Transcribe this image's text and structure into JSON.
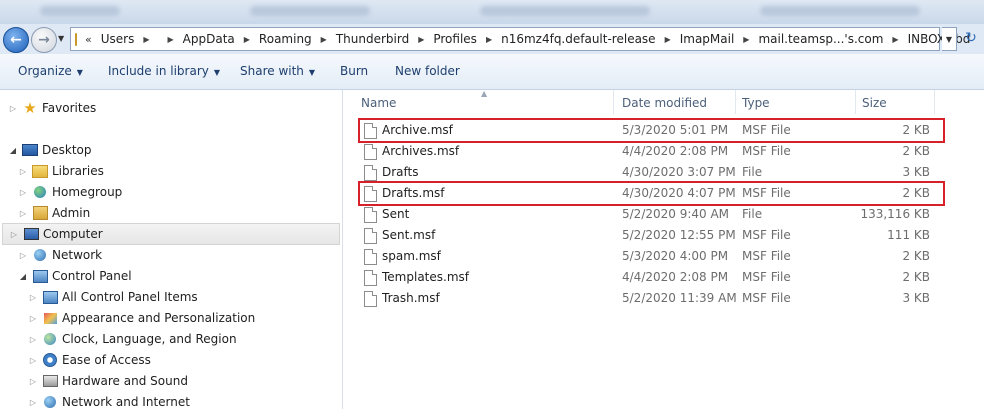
{
  "address": {
    "overflow": "«",
    "crumbs": [
      "Users",
      "",
      "AppData",
      "Roaming",
      "Thunderbird",
      "Profiles",
      "n16mz4fq.default-release",
      "ImapMail",
      "mail.teamsp...'s.com",
      "INBOX.sbd"
    ]
  },
  "toolbar": {
    "organize": "Organize",
    "include_library": "Include in library",
    "share_with": "Share with",
    "burn": "Burn",
    "new_folder": "New folder"
  },
  "nav": {
    "favorites": "Favorites",
    "desktop": "Desktop",
    "libraries": "Libraries",
    "homegroup": "Homegroup",
    "admin": "Admin",
    "computer": "Computer",
    "network": "Network",
    "control_panel": "Control Panel",
    "all_cp_items": "All Control Panel Items",
    "appearance": "Appearance and Personalization",
    "clock": "Clock, Language, and Region",
    "ease": "Ease of Access",
    "hardware": "Hardware and Sound",
    "network_internet": "Network and Internet"
  },
  "columns": {
    "name": "Name",
    "date": "Date modified",
    "type": "Type",
    "size": "Size"
  },
  "files": [
    {
      "name": "Archive.msf",
      "date": "5/3/2020 5:01 PM",
      "type": "MSF File",
      "size": "2 KB"
    },
    {
      "name": "Archives.msf",
      "date": "4/4/2020 2:08 PM",
      "type": "MSF File",
      "size": "2 KB"
    },
    {
      "name": "Drafts",
      "date": "4/30/2020 3:07 PM",
      "type": "File",
      "size": "3 KB"
    },
    {
      "name": "Drafts.msf",
      "date": "4/30/2020 4:07 PM",
      "type": "MSF File",
      "size": "2 KB"
    },
    {
      "name": "Sent",
      "date": "5/2/2020 9:40 AM",
      "type": "File",
      "size": "133,116 KB"
    },
    {
      "name": "Sent.msf",
      "date": "5/2/2020 12:55 PM",
      "type": "MSF File",
      "size": "111 KB"
    },
    {
      "name": "spam.msf",
      "date": "5/3/2020 4:00 PM",
      "type": "MSF File",
      "size": "2 KB"
    },
    {
      "name": "Templates.msf",
      "date": "4/4/2020 2:08 PM",
      "type": "MSF File",
      "size": "2 KB"
    },
    {
      "name": "Trash.msf",
      "date": "5/2/2020 11:39 AM",
      "type": "MSF File",
      "size": "3 KB"
    }
  ],
  "colors": {
    "highlight": "#d6202a",
    "toolbar_text": "#1e3f6e"
  }
}
